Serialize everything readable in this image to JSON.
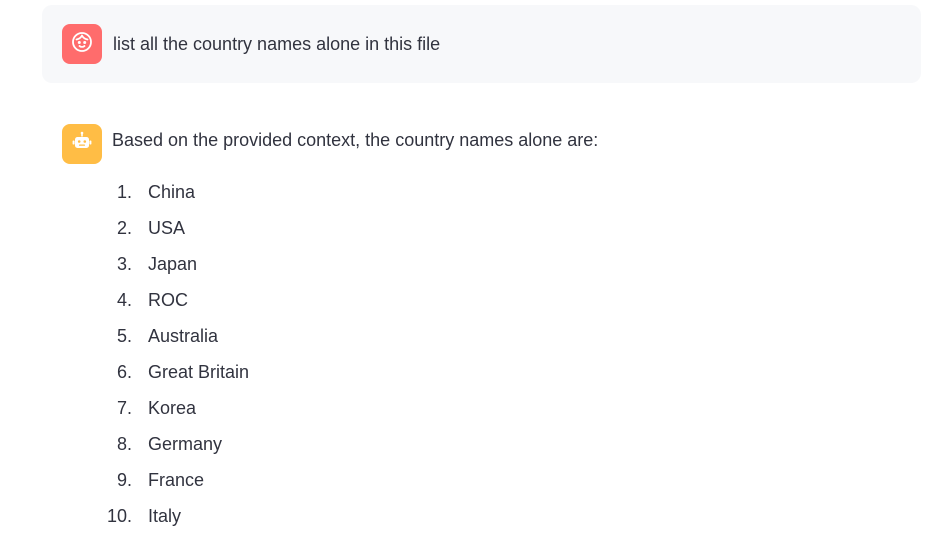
{
  "user_message": {
    "avatar_icon": "face-smile-icon",
    "text": "list all the country names alone in this file"
  },
  "assistant_message": {
    "avatar_icon": "robot-icon",
    "intro": "Based on the provided context, the country names alone are:",
    "items": [
      {
        "number": "1.",
        "name": "China"
      },
      {
        "number": "2.",
        "name": "USA"
      },
      {
        "number": "3.",
        "name": "Japan"
      },
      {
        "number": "4.",
        "name": "ROC"
      },
      {
        "number": "5.",
        "name": "Australia"
      },
      {
        "number": "6.",
        "name": "Great Britain"
      },
      {
        "number": "7.",
        "name": "Korea"
      },
      {
        "number": "8.",
        "name": "Germany"
      },
      {
        "number": "9.",
        "name": "France"
      },
      {
        "number": "10.",
        "name": "Italy"
      }
    ]
  },
  "colors": {
    "user_avatar": "#ff6c6c",
    "bot_avatar": "#ffbd45",
    "user_bubble": "#f7f8fa",
    "text": "#31333f"
  }
}
